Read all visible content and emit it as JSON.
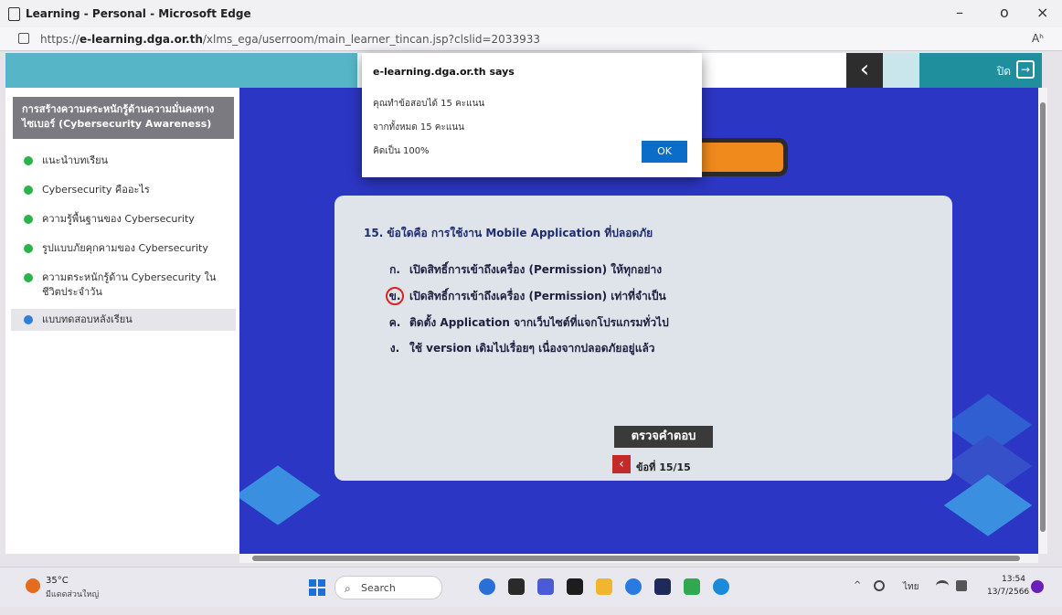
{
  "window": {
    "title": "Learning - Personal - Microsoft Edge",
    "minimize": "–",
    "maximize": "o",
    "close": "×"
  },
  "address_bar": {
    "url_prefix": "https://",
    "url_domain": "e-learning.dga.or.th",
    "url_path": "/xlms_ega/userroom/main_learner_tincan.jsp?clslid=2033933",
    "reader_icon": "Aʰ"
  },
  "header": {
    "back_icon": "‹",
    "close_label": "ปิด",
    "exit_icon": "→"
  },
  "sidebar": {
    "course_title": "การสร้างความตระหนักรู้ด้านความมั่นคงทางไซเบอร์ (Cybersecurity Awareness)",
    "items": [
      {
        "label": "แนะนำบทเรียน"
      },
      {
        "label": "Cybersecurity คืออะไร"
      },
      {
        "label": "ความรู้พื้นฐานของ Cybersecurity"
      },
      {
        "label": "รูปแบบภัยคุกคามของ Cybersecurity"
      },
      {
        "label": "ความตระหนักรู้ด้าน Cybersecurity ในชีวิตประจำวัน"
      },
      {
        "label": "แบบทดสอบหลังเรียน"
      }
    ]
  },
  "question": {
    "text": "15. ข้อใดคือ การใช้งาน Mobile Application ที่ปลอดภัย",
    "options": [
      {
        "letter": "ก.",
        "text": "เปิดสิทธิ์การเข้าถึงเครื่อง (Permission) ให้ทุกอย่าง"
      },
      {
        "letter": "ข.",
        "text": "เปิดสิทธิ์การเข้าถึงเครื่อง (Permission) เท่าที่จำเป็น"
      },
      {
        "letter": "ค.",
        "text": "ติดตั้ง Application จากเว็บไซต์ที่แจกโปรแกรมทั่วไป"
      },
      {
        "letter": "ง.",
        "text": "ใช้ version เดิมไปเรื่อยๆ เนื่องจากปลอดภัยอยู่แล้ว"
      }
    ],
    "check_button": "ตรวจคำตอบ",
    "prev_icon": "‹",
    "page_indicator": "ข้อที่ 15/15"
  },
  "dialog": {
    "title": "e-learning.dga.or.th says",
    "line1": "คุณทำข้อสอบได้ 15 คะแนน",
    "line2": "จากทั้งหมด 15 คะแนน",
    "line3": "คิดเป็น 100%",
    "ok_label": "OK"
  },
  "taskbar": {
    "weather_temp": "35°C",
    "weather_desc": "มีแดดส่วนใหญ่",
    "search_placeholder": "Search",
    "search_icon": "⌕",
    "tray_lang": "ไทย",
    "tray_caret": "^",
    "clock_time": "13:54",
    "clock_date": "13/7/2566"
  }
}
